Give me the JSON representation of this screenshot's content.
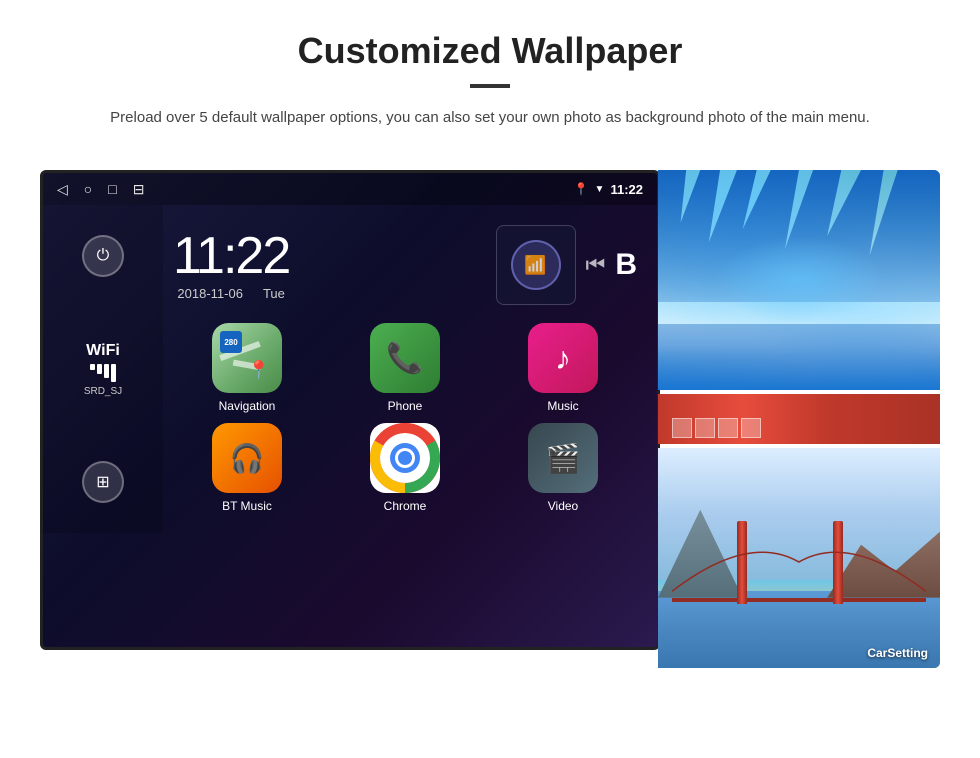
{
  "header": {
    "title": "Customized Wallpaper",
    "description": "Preload over 5 default wallpaper options, you can also set your own photo as background photo of the main menu."
  },
  "device": {
    "status_bar": {
      "time": "11:22",
      "nav_back": "◁",
      "nav_home": "○",
      "nav_recent": "□",
      "nav_screenshot": "⊟",
      "location_icon": "📍",
      "wifi_icon": "▼",
      "time_display": "11:22"
    },
    "clock": {
      "time": "11:22",
      "date": "2018-11-06",
      "day": "Tue"
    },
    "sidebar": {
      "wifi_label": "WiFi",
      "wifi_ssid": "SRD_SJ"
    },
    "apps": [
      {
        "id": "navigation",
        "label": "Navigation",
        "badge": "280"
      },
      {
        "id": "phone",
        "label": "Phone"
      },
      {
        "id": "music",
        "label": "Music"
      },
      {
        "id": "bt-music",
        "label": "BT Music"
      },
      {
        "id": "chrome",
        "label": "Chrome"
      },
      {
        "id": "video",
        "label": "Video"
      }
    ],
    "wallpapers": {
      "bottom_label": "CarSetting"
    }
  }
}
